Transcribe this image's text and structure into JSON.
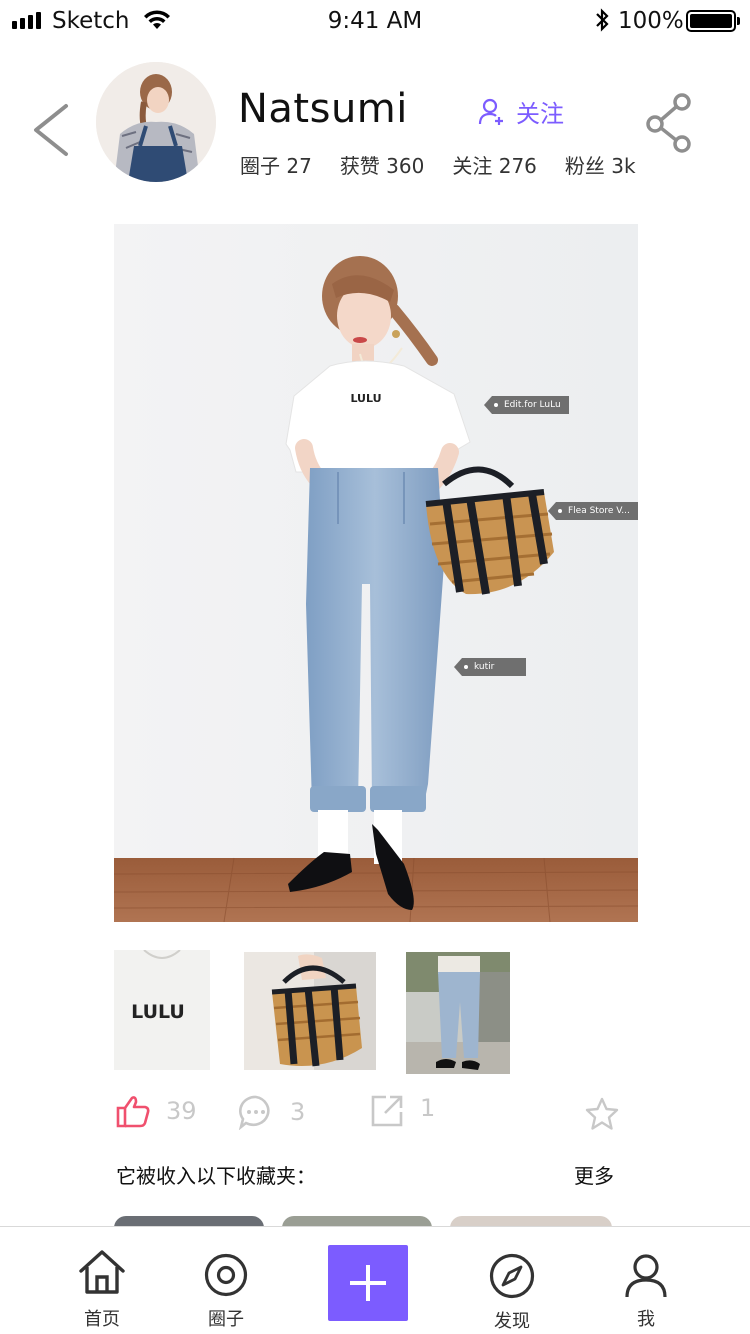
{
  "status_bar": {
    "carrier": "Sketch",
    "time": "9:41 AM",
    "battery": "100%"
  },
  "profile": {
    "name": "Natsumi",
    "follow_label": "关注",
    "stats": [
      {
        "label": "圈子",
        "value": "27"
      },
      {
        "label": "获赞",
        "value": "360"
      },
      {
        "label": "关注",
        "value": "276"
      },
      {
        "label": "粉丝",
        "value": "3k"
      }
    ]
  },
  "post": {
    "tags": [
      {
        "label": "Edit.for LuLu"
      },
      {
        "label": "Flea Store V..."
      },
      {
        "label": "kutir"
      }
    ],
    "tshirt_print": "LULU",
    "thumb_print": "LULU"
  },
  "actions": {
    "likes": "39",
    "comments": "3",
    "shares": "1"
  },
  "collections": {
    "title": "它被收入以下收藏夹：",
    "more_label": "更多"
  },
  "tabbar": {
    "items": [
      {
        "label": "首页",
        "icon": "home-icon"
      },
      {
        "label": "圈子",
        "icon": "circle-icon"
      },
      {
        "label": "",
        "icon": "plus-icon"
      },
      {
        "label": "发现",
        "icon": "compass-icon"
      },
      {
        "label": "我",
        "icon": "person-icon"
      }
    ]
  },
  "colors": {
    "accent": "#7c5cff",
    "like": "#f0506e",
    "muted": "#c8c8c8"
  }
}
